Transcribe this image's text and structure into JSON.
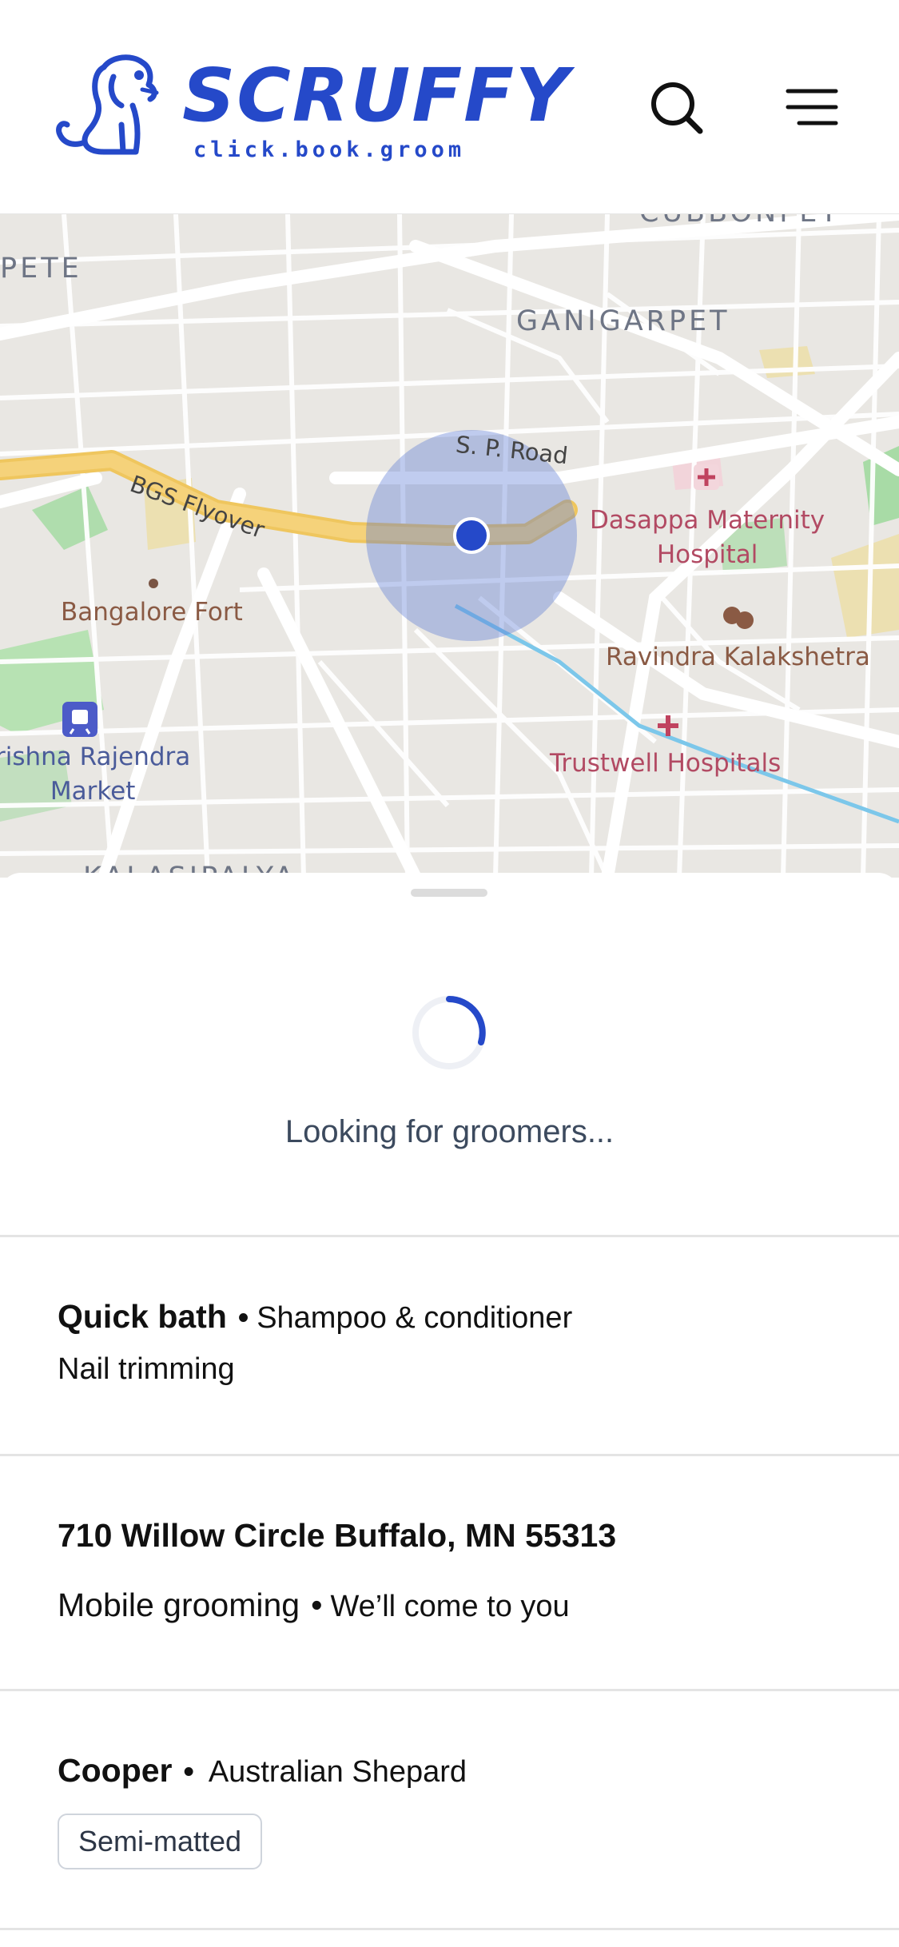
{
  "header": {
    "logo_word": "SCRUFFY",
    "logo_tagline": "click.book.groom",
    "brand_color": "#2549c9",
    "search_icon": "search-icon",
    "menu_icon": "hamburger-menu-icon"
  },
  "map": {
    "labels": {
      "area_top_left": "PETE",
      "area_top_right": "CUBBONPET",
      "area_ganigarpet": "GANIGARPET",
      "road_sp": "S. P. Road",
      "road_bgs": "BGS Flyover",
      "hospital_dasappa": "Dasappa Maternity\nHospital",
      "poi_fort": "Bangalore Fort",
      "poi_kalakshetra": "Ravindra Kalakshetra",
      "market": "rishna Rajendra\nMarket",
      "hospital_trustwell": "Trustwell Hospitals",
      "area_bottom": "KALASIPALYA"
    }
  },
  "sheet": {
    "status": "Looking for groomers...",
    "service": {
      "name": "Quick bath",
      "detail_1": "Shampoo & conditioner",
      "detail_2": "Nail trimming"
    },
    "address": {
      "line": "710 Willow Circle Buffalo, MN 55313",
      "mode": "Mobile grooming",
      "mode_detail": "We’ll come to you"
    },
    "pet": {
      "name": "Cooper",
      "breed": "Australian Shepard",
      "badge": "Semi-matted"
    },
    "separator": "•"
  }
}
